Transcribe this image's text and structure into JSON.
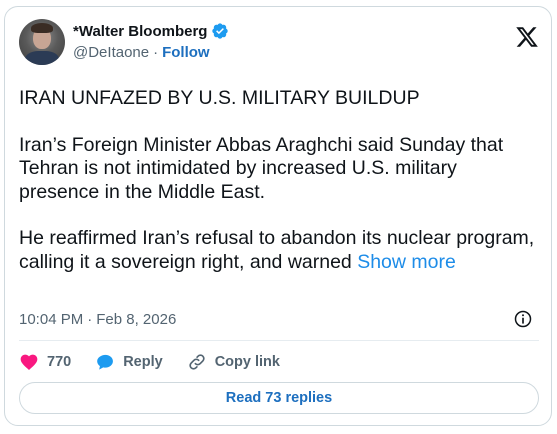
{
  "author": {
    "display_name": "*Walter Bloomberg",
    "handle": "@DeItaone",
    "separator": "·",
    "follow_label": "Follow"
  },
  "tweet": {
    "paragraphs": [
      "IRAN UNFAZED BY U.S. MILITARY BUILDUP",
      "Iran’s Foreign Minister Abbas Araghchi said Sunday that Tehran is not intimidated by increased U.S. military presence in the Middle East.",
      "He reaffirmed Iran’s refusal to abandon its nuclear program, calling it a sovereign right, and warned "
    ],
    "show_more": "Show more"
  },
  "meta": {
    "time": "10:04 PM",
    "separator": "·",
    "date": "Feb 8, 2026"
  },
  "actions": {
    "like_count": "770",
    "reply_label": "Reply",
    "copy_link_label": "Copy link"
  },
  "replies_button": "Read 73 replies",
  "colors": {
    "like": "#f91880",
    "reply": "#1d9bf0",
    "link": "#1d6fbf",
    "verified": "#1d9bf0"
  },
  "icons": [
    "verified-badge-icon",
    "x-logo-icon",
    "info-icon",
    "heart-icon",
    "reply-bubble-icon",
    "link-icon"
  ]
}
